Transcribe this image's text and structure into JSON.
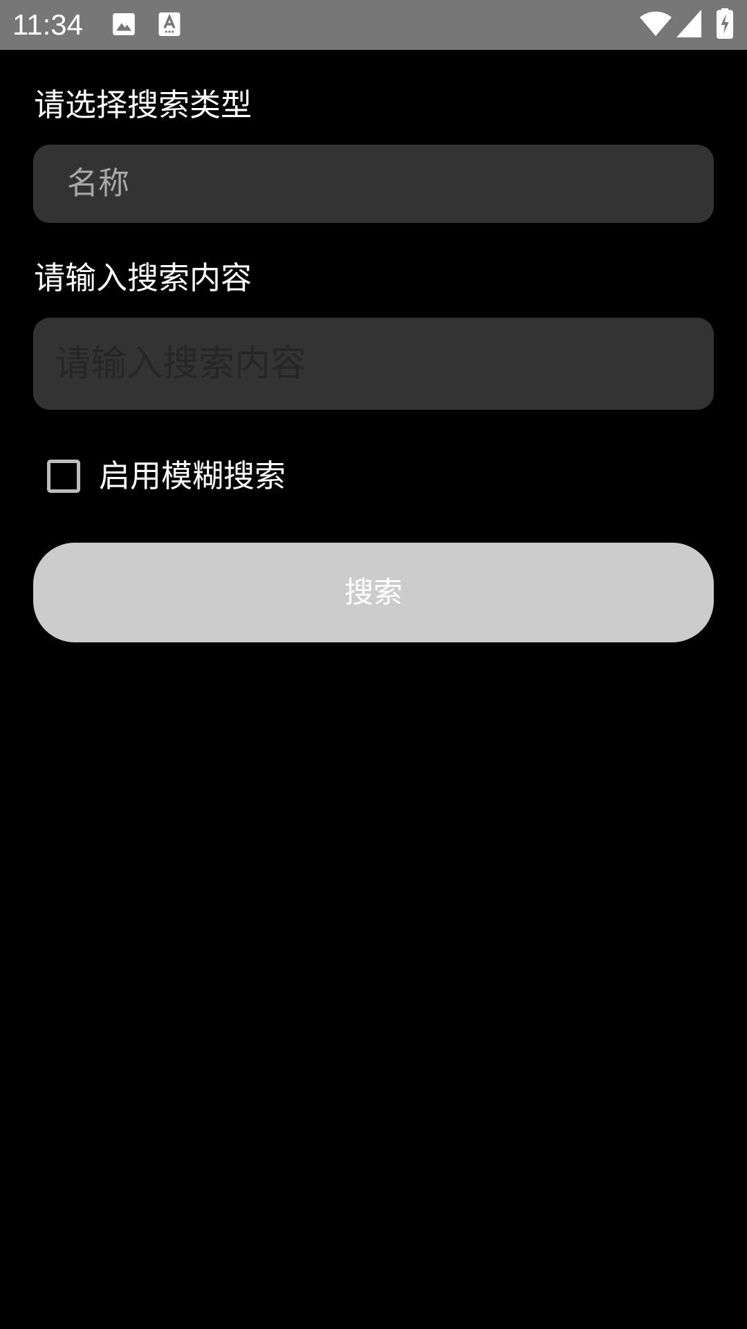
{
  "status_bar": {
    "time": "11:34",
    "icons": [
      "image-icon",
      "font-download-icon",
      "wifi-icon",
      "signal-icon",
      "battery-charging-icon"
    ]
  },
  "form": {
    "search_type_label": "请选择搜索类型",
    "search_type_selected": "名称",
    "search_content_label": "请输入搜索内容",
    "search_content_placeholder": "请输入搜索内容",
    "search_content_value": "",
    "fuzzy_search_label": "启用模糊搜索",
    "fuzzy_search_checked": false,
    "search_button_label": "搜索"
  },
  "colors": {
    "background": "#000000",
    "status_bar": "#777777",
    "field_bg": "#333333",
    "button_bg": "#cccccc"
  }
}
